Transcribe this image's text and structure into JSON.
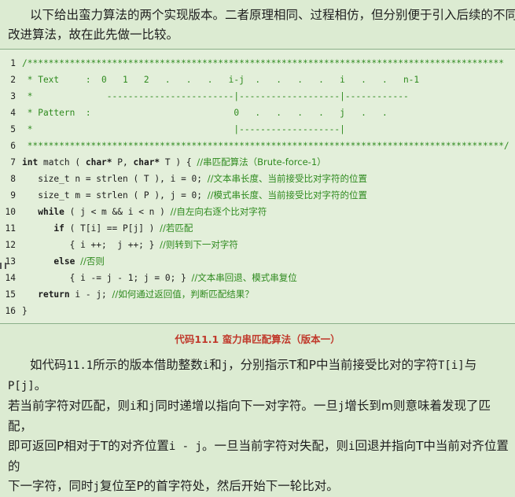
{
  "intro": {
    "line1": "以下给出蛮力算法的两个实现版本。二者原理相同、过程相仿，但分别便于引入后续的不同",
    "line2": "改进算法，故在此先做一比较。"
  },
  "code": {
    "lines": [
      {
        "n": "1",
        "text": "/******************************************************************************************"
      },
      {
        "n": "2",
        "text": " * Text     :  0   1   2   .   .   .   i-j  .   .   .   .   i   .   .   n-1"
      },
      {
        "n": "3",
        "text": " *              ------------------------|-------------------|------------"
      },
      {
        "n": "4",
        "text": " * Pattern  :                           0   .   .   .   .   j   .   ."
      },
      {
        "n": "5",
        "text": " *                                      |-------------------|"
      },
      {
        "n": "6",
        "text": " ******************************************************************************************/"
      },
      {
        "n": "7",
        "pre": "int match ( char* P, char* T ) { ",
        "cm": "//串匹配算法（Brute-force-1）"
      },
      {
        "n": "8",
        "pre": "   size_t n = strlen ( T ), i = 0; ",
        "cm": "//文本串长度、当前接受比对字符的位置"
      },
      {
        "n": "9",
        "pre": "   size_t m = strlen ( P ), j = 0; ",
        "cm": "//模式串长度、当前接受比对字符的位置"
      },
      {
        "n": "10",
        "pre": "   while ( j < m && i < n ) ",
        "cm": "//自左向右逐个比对字符"
      },
      {
        "n": "11",
        "pre": "      if ( T[i] == P[j] ) ",
        "cm": "//若匹配"
      },
      {
        "n": "12",
        "pre": "         { i ++;  j ++; } ",
        "cm": "//则转到下一对字符"
      },
      {
        "n": "13",
        "pre": "      else ",
        "cm": "//否则"
      },
      {
        "n": "14",
        "pre": "         { i -= j - 1; j = 0; } ",
        "cm": "//文本串回退、模式串复位"
      },
      {
        "n": "15",
        "pre": "   return i - j; ",
        "cm": "//如何通过返回值，判断匹配结果？"
      },
      {
        "n": "16",
        "pre": "}",
        "cm": ""
      }
    ]
  },
  "caption": "代码11.1  蛮力串匹配算法（版本一）",
  "explain": {
    "l1a": "如代码",
    "l1b": "11.1",
    "l1c": "所示的版本借助整数",
    "l1d": "i",
    "l1e": "和",
    "l1f": "j",
    "l1g": "，分别指示T和P中当前接受比对的字符",
    "l1h": "T[i]",
    "l1i": "与",
    "l1j": "P[j]",
    "l1k": "。",
    "l2a": "若当前字符对匹配，则",
    "l2b": "i",
    "l2c": "和",
    "l2d": "j",
    "l2e": "同时递增以指向下一对字符。一旦",
    "l2f": "j",
    "l2g": "增长到m则意味着发现了匹配，",
    "l3a": "即可返回P相对于T的对齐位置",
    "l3b": "i - j",
    "l3c": "。一旦当前字符对失配，则",
    "l3d": "i",
    "l3e": "回退并指向T中当前对齐位置的",
    "l4a": "下一字符，同时",
    "l4b": "j",
    "l4c": "复位至P的首字符处，然后开始下一轮比对。"
  }
}
